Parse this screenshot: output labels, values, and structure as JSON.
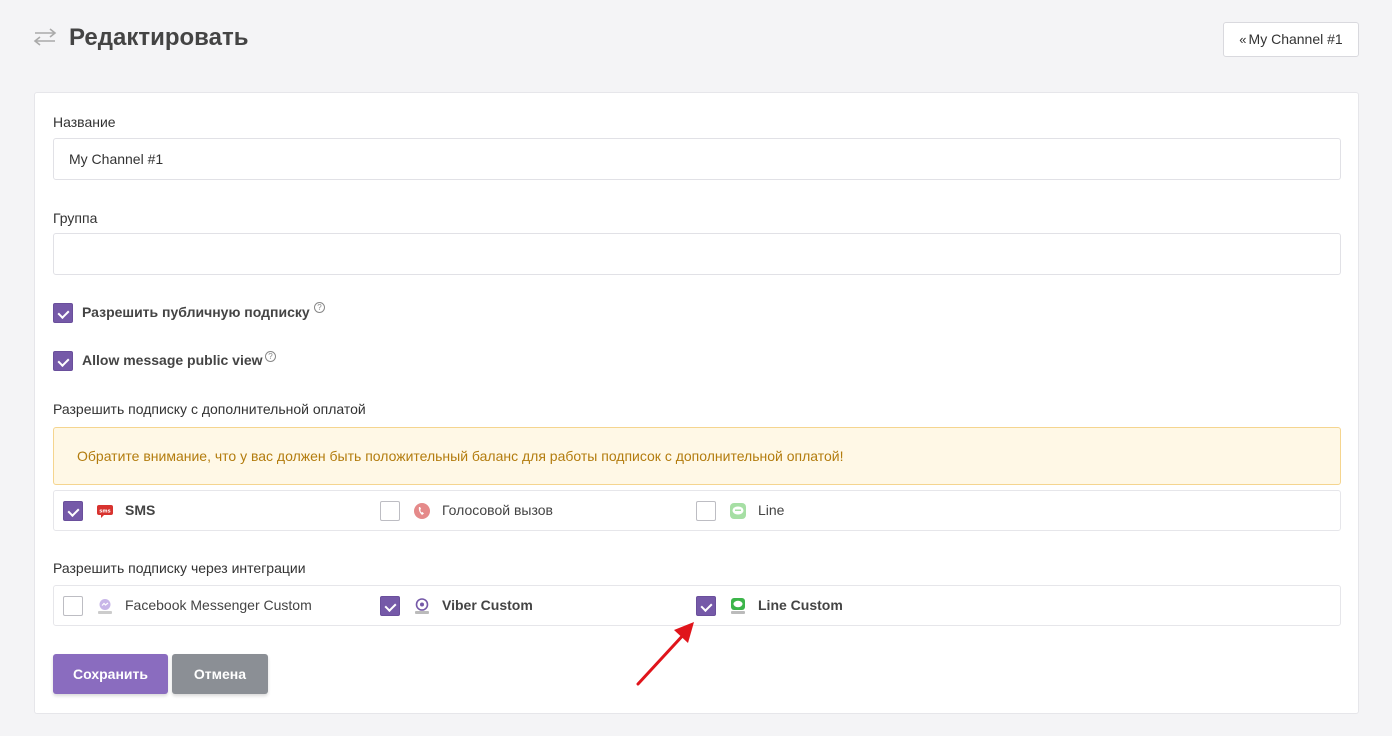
{
  "header": {
    "title": "Редактировать",
    "back_button": "My Channel #1",
    "icon": "swap-arrows-icon"
  },
  "form": {
    "name": {
      "label": "Название",
      "value": "My Channel #1"
    },
    "group": {
      "label": "Группа",
      "value": ""
    },
    "public_subscribe": {
      "label": "Разрешить публичную подписку",
      "checked": true
    },
    "public_view": {
      "label": "Allow message public view",
      "checked": true
    },
    "paid_section": {
      "label": "Разрешить подписку с дополнительной оплатой",
      "notice": "Обратите внимание, что у вас должен быть положительный баланс для работы подписок с дополнительной оплатой!",
      "options": [
        {
          "label": "SMS",
          "checked": true,
          "icon": "sms-icon"
        },
        {
          "label": "Голосовой вызов",
          "checked": false,
          "icon": "phone-icon"
        },
        {
          "label": "Line",
          "checked": false,
          "icon": "line-icon"
        }
      ]
    },
    "integrations_section": {
      "label": "Разрешить подписку через интеграции",
      "options": [
        {
          "label": "Facebook Messenger Custom",
          "checked": false,
          "icon": "messenger-icon"
        },
        {
          "label": "Viber Custom",
          "checked": true,
          "icon": "viber-icon"
        },
        {
          "label": "Line Custom",
          "checked": true,
          "icon": "line-icon"
        }
      ]
    }
  },
  "actions": {
    "save": "Сохранить",
    "cancel": "Отмена"
  },
  "colors": {
    "accent": "#7559a8",
    "save_button": "#8a6cbf",
    "cancel_button": "#8b8f95",
    "notice_bg": "#fff8e6",
    "notice_text": "#b37c0e",
    "annotation_arrow": "#e0141b"
  }
}
